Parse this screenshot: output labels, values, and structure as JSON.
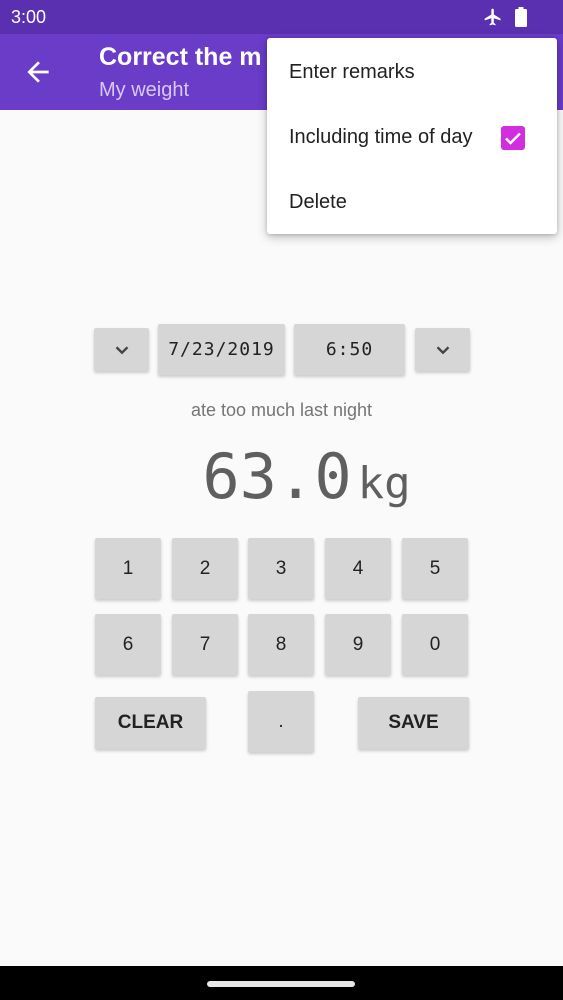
{
  "status_bar": {
    "time": "3:00",
    "icons": [
      "airplane-mode-icon",
      "battery-icon"
    ]
  },
  "app_bar": {
    "title": "Correct the m",
    "subtitle": "My weight"
  },
  "overflow_menu": {
    "items": [
      {
        "label": "Enter remarks"
      },
      {
        "label": "Including time of day",
        "checked": true
      },
      {
        "label": "Delete"
      }
    ]
  },
  "datetime": {
    "date": "7/23/2019",
    "time": "6:50"
  },
  "remarks": "ate too much last night",
  "weight": {
    "value": "63.0",
    "unit": "kg"
  },
  "keypad": {
    "row1": [
      "1",
      "2",
      "3",
      "4",
      "5"
    ],
    "row2": [
      "6",
      "7",
      "8",
      "9",
      "0"
    ],
    "clear": "CLEAR",
    "dot": ".",
    "save": "SAVE"
  },
  "colors": {
    "status_bar": "#5a2fb0",
    "app_bar": "#6a3cc8",
    "checkbox": "#d12ee0",
    "button": "#d6d6d6"
  }
}
